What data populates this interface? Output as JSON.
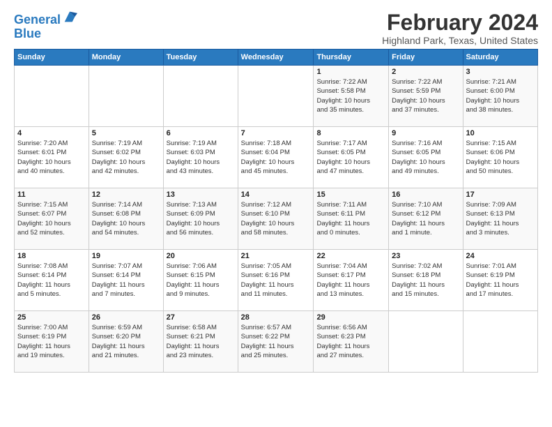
{
  "logo": {
    "line1": "General",
    "line2": "Blue"
  },
  "title": "February 2024",
  "subtitle": "Highland Park, Texas, United States",
  "weekdays": [
    "Sunday",
    "Monday",
    "Tuesday",
    "Wednesday",
    "Thursday",
    "Friday",
    "Saturday"
  ],
  "weeks": [
    [
      {
        "day": "",
        "info": ""
      },
      {
        "day": "",
        "info": ""
      },
      {
        "day": "",
        "info": ""
      },
      {
        "day": "",
        "info": ""
      },
      {
        "day": "1",
        "info": "Sunrise: 7:22 AM\nSunset: 5:58 PM\nDaylight: 10 hours\nand 35 minutes."
      },
      {
        "day": "2",
        "info": "Sunrise: 7:22 AM\nSunset: 5:59 PM\nDaylight: 10 hours\nand 37 minutes."
      },
      {
        "day": "3",
        "info": "Sunrise: 7:21 AM\nSunset: 6:00 PM\nDaylight: 10 hours\nand 38 minutes."
      }
    ],
    [
      {
        "day": "4",
        "info": "Sunrise: 7:20 AM\nSunset: 6:01 PM\nDaylight: 10 hours\nand 40 minutes."
      },
      {
        "day": "5",
        "info": "Sunrise: 7:19 AM\nSunset: 6:02 PM\nDaylight: 10 hours\nand 42 minutes."
      },
      {
        "day": "6",
        "info": "Sunrise: 7:19 AM\nSunset: 6:03 PM\nDaylight: 10 hours\nand 43 minutes."
      },
      {
        "day": "7",
        "info": "Sunrise: 7:18 AM\nSunset: 6:04 PM\nDaylight: 10 hours\nand 45 minutes."
      },
      {
        "day": "8",
        "info": "Sunrise: 7:17 AM\nSunset: 6:05 PM\nDaylight: 10 hours\nand 47 minutes."
      },
      {
        "day": "9",
        "info": "Sunrise: 7:16 AM\nSunset: 6:05 PM\nDaylight: 10 hours\nand 49 minutes."
      },
      {
        "day": "10",
        "info": "Sunrise: 7:15 AM\nSunset: 6:06 PM\nDaylight: 10 hours\nand 50 minutes."
      }
    ],
    [
      {
        "day": "11",
        "info": "Sunrise: 7:15 AM\nSunset: 6:07 PM\nDaylight: 10 hours\nand 52 minutes."
      },
      {
        "day": "12",
        "info": "Sunrise: 7:14 AM\nSunset: 6:08 PM\nDaylight: 10 hours\nand 54 minutes."
      },
      {
        "day": "13",
        "info": "Sunrise: 7:13 AM\nSunset: 6:09 PM\nDaylight: 10 hours\nand 56 minutes."
      },
      {
        "day": "14",
        "info": "Sunrise: 7:12 AM\nSunset: 6:10 PM\nDaylight: 10 hours\nand 58 minutes."
      },
      {
        "day": "15",
        "info": "Sunrise: 7:11 AM\nSunset: 6:11 PM\nDaylight: 11 hours\nand 0 minutes."
      },
      {
        "day": "16",
        "info": "Sunrise: 7:10 AM\nSunset: 6:12 PM\nDaylight: 11 hours\nand 1 minute."
      },
      {
        "day": "17",
        "info": "Sunrise: 7:09 AM\nSunset: 6:13 PM\nDaylight: 11 hours\nand 3 minutes."
      }
    ],
    [
      {
        "day": "18",
        "info": "Sunrise: 7:08 AM\nSunset: 6:14 PM\nDaylight: 11 hours\nand 5 minutes."
      },
      {
        "day": "19",
        "info": "Sunrise: 7:07 AM\nSunset: 6:14 PM\nDaylight: 11 hours\nand 7 minutes."
      },
      {
        "day": "20",
        "info": "Sunrise: 7:06 AM\nSunset: 6:15 PM\nDaylight: 11 hours\nand 9 minutes."
      },
      {
        "day": "21",
        "info": "Sunrise: 7:05 AM\nSunset: 6:16 PM\nDaylight: 11 hours\nand 11 minutes."
      },
      {
        "day": "22",
        "info": "Sunrise: 7:04 AM\nSunset: 6:17 PM\nDaylight: 11 hours\nand 13 minutes."
      },
      {
        "day": "23",
        "info": "Sunrise: 7:02 AM\nSunset: 6:18 PM\nDaylight: 11 hours\nand 15 minutes."
      },
      {
        "day": "24",
        "info": "Sunrise: 7:01 AM\nSunset: 6:19 PM\nDaylight: 11 hours\nand 17 minutes."
      }
    ],
    [
      {
        "day": "25",
        "info": "Sunrise: 7:00 AM\nSunset: 6:19 PM\nDaylight: 11 hours\nand 19 minutes."
      },
      {
        "day": "26",
        "info": "Sunrise: 6:59 AM\nSunset: 6:20 PM\nDaylight: 11 hours\nand 21 minutes."
      },
      {
        "day": "27",
        "info": "Sunrise: 6:58 AM\nSunset: 6:21 PM\nDaylight: 11 hours\nand 23 minutes."
      },
      {
        "day": "28",
        "info": "Sunrise: 6:57 AM\nSunset: 6:22 PM\nDaylight: 11 hours\nand 25 minutes."
      },
      {
        "day": "29",
        "info": "Sunrise: 6:56 AM\nSunset: 6:23 PM\nDaylight: 11 hours\nand 27 minutes."
      },
      {
        "day": "",
        "info": ""
      },
      {
        "day": "",
        "info": ""
      }
    ]
  ]
}
